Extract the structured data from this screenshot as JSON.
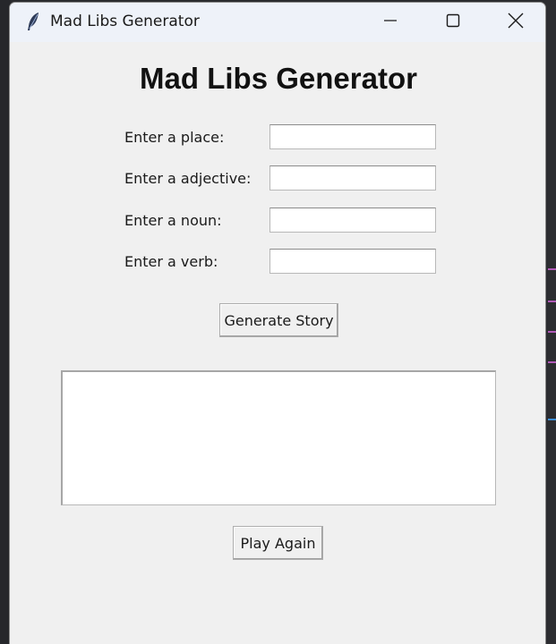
{
  "window": {
    "title": "Mad Libs Generator",
    "controls": {
      "minimize": "minimize-icon",
      "maximize": "maximize-icon",
      "close": "close-icon"
    }
  },
  "app": {
    "heading": "Mad Libs Generator",
    "fields": [
      {
        "label": "Enter a place:",
        "value": ""
      },
      {
        "label": "Enter a adjective:",
        "value": ""
      },
      {
        "label": "Enter a noun:",
        "value": ""
      },
      {
        "label": "Enter a verb:",
        "value": ""
      }
    ],
    "generate_label": "Generate Story",
    "story_text": "",
    "play_again_label": "Play Again"
  },
  "colors": {
    "window_bg": "#f0f0f0",
    "titlebar_bg": "#eef2f9",
    "desktop_bg": "#2a2b2f"
  }
}
